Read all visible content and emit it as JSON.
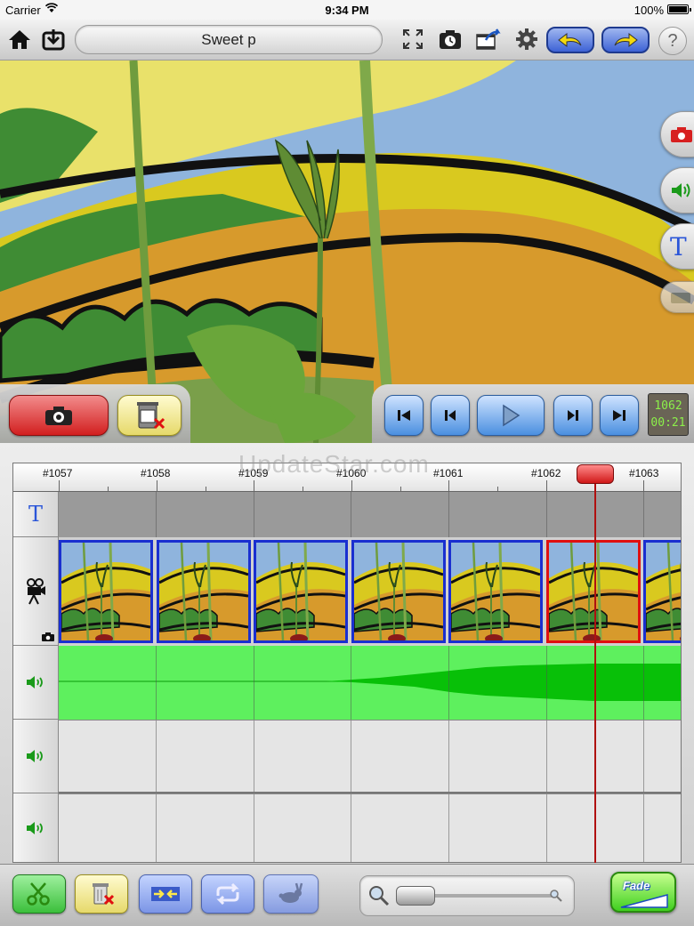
{
  "status_bar": {
    "carrier": "Carrier",
    "time": "9:34 PM",
    "battery": "100%"
  },
  "toolbar": {
    "project_title": "Sweet p",
    "help_label": "?",
    "icons": [
      "home-icon",
      "import-icon",
      "fullscreen-icon",
      "timelapse-camera-icon",
      "export-icon",
      "gear-icon",
      "undo-icon",
      "redo-icon"
    ]
  },
  "side_tabs": {
    "text_tab": "T",
    "icons": [
      "camera-icon",
      "speaker-icon",
      "text-icon",
      "overlay-icon"
    ]
  },
  "preview": {
    "counter_frame": "1062",
    "counter_time": "00:21",
    "icons": [
      "camera-icon",
      "delete-frame-icon",
      "skip-to-start-icon",
      "step-back-icon",
      "play-icon",
      "step-forward-icon",
      "skip-to-end-icon"
    ]
  },
  "timeline": {
    "ruler_labels": [
      "#1057",
      "#1058",
      "#1059",
      "#1060",
      "#1061",
      "#1062",
      "#1063"
    ],
    "text_track_label": "T",
    "frame_count": 7,
    "selected_frame": "#1062",
    "audio_tracks": 3
  },
  "watermark": "UpdateStar.com",
  "bottom_bar": {
    "fade_label": "Fade",
    "icons": [
      "scissors-icon",
      "trash-icon",
      "merge-icon",
      "loop-icon",
      "rabbit-icon",
      "zoom-out-icon",
      "zoom-in-icon"
    ]
  },
  "colors": {
    "accent_blue": "#3d62d6",
    "record_red": "#d21f1f",
    "audio_green": "#5ef05e",
    "frame_border": "#1a2fd0",
    "selection_red": "#e01010"
  }
}
